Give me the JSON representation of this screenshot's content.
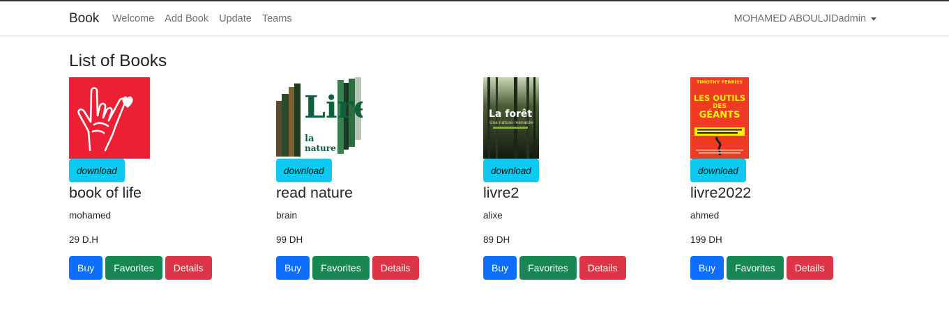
{
  "navbar": {
    "brand": "Book",
    "links": [
      "Welcome",
      "Add Book",
      "Update",
      "Teams"
    ],
    "user": "MOHAMED ABOULJIDadmin"
  },
  "page": {
    "title": "List of Books"
  },
  "books": [
    {
      "download_label": "download",
      "title": "book of life",
      "author": "mohamed",
      "price": "29 D.H",
      "buy_label": "Buy",
      "favorites_label": "Favorites",
      "details_label": "Details",
      "cover": {
        "icon": "hand-heart-cover",
        "color": "#ed1f34"
      }
    },
    {
      "download_label": "download",
      "title": "read nature",
      "author": "brain",
      "price": "99 DH",
      "buy_label": "Buy",
      "favorites_label": "Favorites",
      "details_label": "Details",
      "cover": {
        "icon": "lire-la-nature-cover",
        "word1": "Lire",
        "word2": "la",
        "word3": "nature",
        "color": "#0f5e3c"
      }
    },
    {
      "download_label": "download",
      "title": "livre2",
      "author": "alixe",
      "price": "89 DH",
      "buy_label": "Buy",
      "favorites_label": "Favorites",
      "details_label": "Details",
      "cover": {
        "icon": "forest-cover",
        "title": "La forêt",
        "subtitle": "Une nature menacée",
        "color": "#1b2418"
      }
    },
    {
      "download_label": "download",
      "title": "livre2022",
      "author": "ahmed",
      "price": "199 DH",
      "buy_label": "Buy",
      "favorites_label": "Favorites",
      "details_label": "Details",
      "cover": {
        "icon": "outils-des-geants-cover",
        "author": "TIMOTHY FERRISS",
        "line1": "LES OUTILS",
        "line2": "DES",
        "line3": "GÉANTS",
        "color": "#ef3b23",
        "accent": "#fff200"
      }
    }
  ]
}
